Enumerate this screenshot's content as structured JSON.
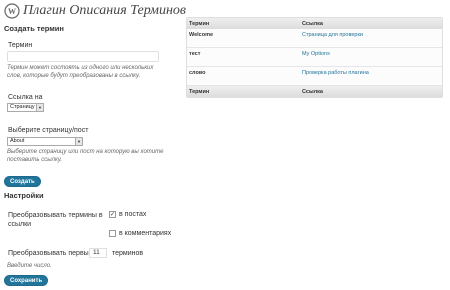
{
  "header": {
    "title": "Плагин Описания Терминов",
    "logo_icon": "wordpress-logo-icon"
  },
  "create_term": {
    "heading": "Создать термин",
    "term_label": "Термин",
    "term_value": "",
    "term_desc_line1": "Термин может состоять из одного или нескольких",
    "term_desc_line2": "слов, которые будут преобразованы в ссылку.",
    "link_to_label": "Ссылка на",
    "link_to_selected": "Страницу",
    "page_label": "Выберите страницу/пост",
    "page_selected": "About",
    "page_desc_line1": "Выберите страницу или пост на которую вы хотите",
    "page_desc_line2": "поставить ссылку.",
    "create_button": "Создать"
  },
  "settings": {
    "heading": "Настройки",
    "convert_label_line1": "Преобразовывать термины в",
    "convert_label_line2": "ссылки",
    "in_posts_label": "в постах",
    "in_posts_checked": true,
    "in_comments_label": "в комментариях",
    "in_comments_checked": false,
    "first_label": "Преобразовывать первые",
    "first_value": "11",
    "first_suffix": "терминов",
    "number_hint": "Введите число.",
    "save_button": "Сохранить"
  },
  "terms_table": {
    "col_term": "Термин",
    "col_link": "Ссылка",
    "rows": [
      {
        "term": "Welcome",
        "link": "Страница для проверки"
      },
      {
        "term": "тест",
        "link": "My Options"
      },
      {
        "term": "слово",
        "link": "Проверка работы плагина"
      }
    ]
  }
}
